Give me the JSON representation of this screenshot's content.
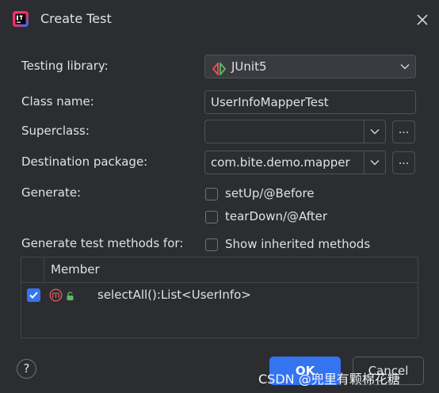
{
  "dialog": {
    "title": "Create Test"
  },
  "form": {
    "testing_library_label": "Testing library:",
    "testing_library_value": "JUnit5",
    "class_name_label": "Class name:",
    "class_name_value": "UserInfoMapperTest",
    "superclass_label": "Superclass:",
    "superclass_value": "",
    "destination_label": "Destination package:",
    "destination_value": "com.bite.demo.mapper",
    "browse_label": "...",
    "generate_label": "Generate:",
    "setup_label": "setUp/@Before",
    "setup_checked": false,
    "teardown_label": "tearDown/@After",
    "teardown_checked": false,
    "methods_for_label": "Generate test methods for:",
    "show_inherited_label": "Show inherited methods",
    "show_inherited_checked": false
  },
  "table": {
    "header": "Member",
    "rows": [
      {
        "checked": true,
        "text": "selectAll():List<UserInfo>"
      }
    ]
  },
  "footer": {
    "help": "?",
    "ok": "OK",
    "cancel": "Cancel"
  },
  "watermark": "CSDN @兜里有颗棉花糖",
  "colors": {
    "background": "#2b2d30",
    "accent": "#3574f0",
    "junit_red": "#e05555",
    "junit_green": "#5fb865",
    "method_red": "#e05555"
  },
  "icons": {
    "app": "intellij-idea-icon",
    "close": "close-icon",
    "library": "junit-icon",
    "method": "method-icon",
    "access": "lock-icon",
    "help": "help-icon"
  }
}
